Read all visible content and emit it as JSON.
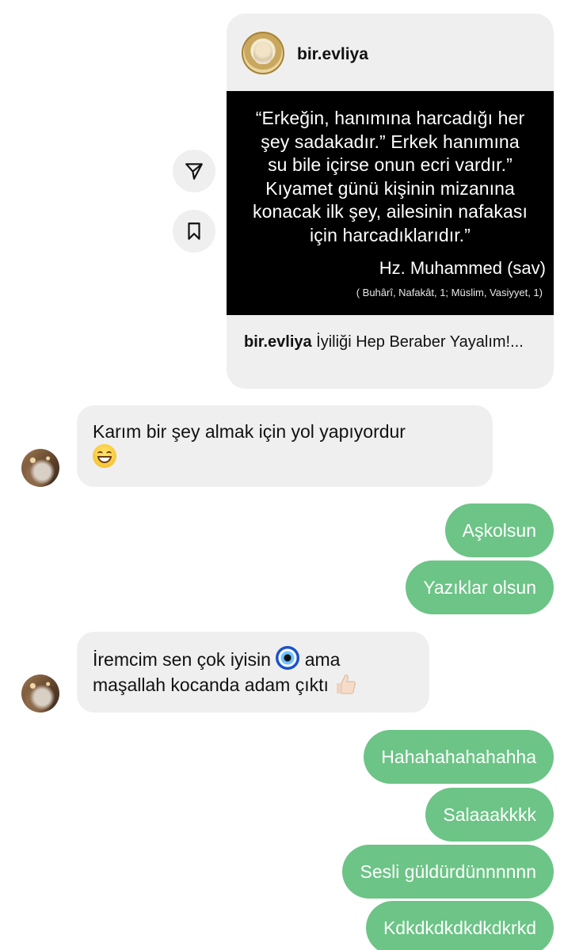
{
  "shared_post": {
    "username": "bir.evliya",
    "quote_lines": [
      "“Erkeğin, hanımına harcadığı her",
      "şey sadakadır.” Erkek hanımına",
      "su bile içirse onun ecri vardır.”",
      "Kıyamet günü kişinin mizanına",
      "konacak ilk şey, ailesinin nafakası",
      "için harcadıklarıdır.”"
    ],
    "quote_author": "Hz. Muhammed (sav)",
    "quote_source": "( Buhârî, Nafakât, 1; Müslim, Vasiyyet, 1)",
    "caption_username": "bir.evliya",
    "caption_text": " İyiliği Hep Beraber Yayalım!...",
    "share_icon": "send-icon",
    "save_icon": "bookmark-icon"
  },
  "messages": {
    "in_1": {
      "text": "Karım bir şey almak için yol yapıyordur",
      "emoji": "grinning-face"
    },
    "out_1": "Aşkolsun",
    "out_2": "Yazıklar olsun",
    "in_2": {
      "part1": "İremcim sen çok iyisin",
      "part2": " ama",
      "part3": "maşallah kocanda adam çıktı",
      "emoji1": "nazar-amulet",
      "emoji2": "thumbs-up"
    },
    "out_3": "Hahahahahahahha",
    "out_4": "Salaaakkkk",
    "out_5": "Sesli güldürdünnnnnn",
    "out_6": "Kdkdkdkdkdkdkrkd"
  },
  "colors": {
    "sent_bubble": "#6cc486",
    "received_bubble": "#efefef",
    "post_image_bg": "#000000"
  }
}
